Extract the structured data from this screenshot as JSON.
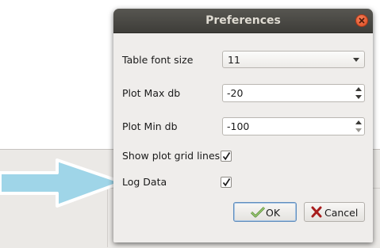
{
  "dialog": {
    "title": "Preferences",
    "close_icon": "close-icon"
  },
  "fields": {
    "table_font_size": {
      "label": "Table font size",
      "value": "11"
    },
    "plot_max_db": {
      "label": "Plot Max db",
      "value": "-20"
    },
    "plot_min_db": {
      "label": "Plot Min db",
      "value": "-100"
    },
    "show_plot_grid_lines": {
      "label": "Show plot grid lines",
      "checked": true
    },
    "log_data": {
      "label": "Log Data",
      "checked": true
    }
  },
  "buttons": {
    "ok": {
      "label": "OK",
      "icon": "check-icon"
    },
    "cancel": {
      "label": "Cancel",
      "icon": "x-icon"
    }
  },
  "annotation": {
    "icon": "arrow-right-icon",
    "color": "#9fd5e8"
  },
  "colors": {
    "titlebar": "#4a4945",
    "dialog_bg": "#efedeb",
    "close_button": "#e9572b",
    "default_button_border": "#5f8dbd"
  }
}
